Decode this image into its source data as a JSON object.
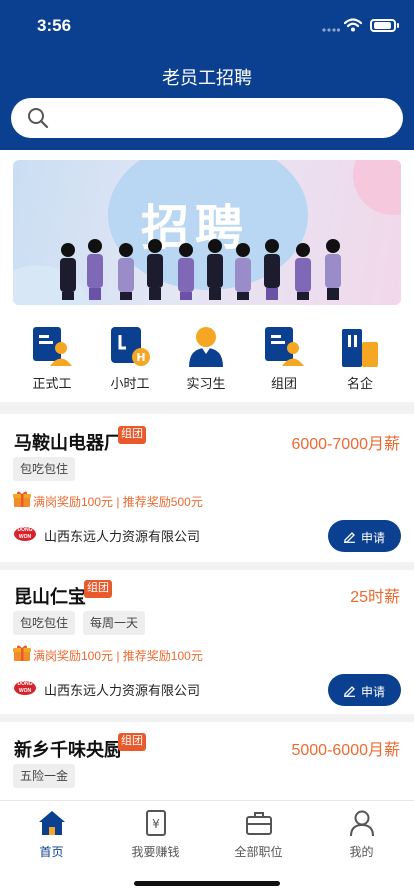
{
  "status_bar": {
    "time": "3:56"
  },
  "header": {
    "title": "老员工招聘",
    "search_placeholder": ""
  },
  "banner": {
    "text": "招聘"
  },
  "categories": [
    {
      "label": "正式工",
      "icon": "fulltime-icon"
    },
    {
      "label": "小时工",
      "icon": "hourly-icon"
    },
    {
      "label": "实习生",
      "icon": "intern-icon"
    },
    {
      "label": "组团",
      "icon": "group-icon"
    },
    {
      "label": "名企",
      "icon": "enterprise-icon"
    }
  ],
  "jobs": [
    {
      "name": "马鞍山电器厂",
      "badge": "组团",
      "salary": "6000-7000月薪",
      "tags": [
        "包吃包住"
      ],
      "reward": "满岗奖励100元 | 推荐奖励500元",
      "logo_text": "DONG WON",
      "company": "山西东远人力资源有限公司",
      "apply_label": "申请"
    },
    {
      "name": "昆山仁宝",
      "badge": "组团",
      "salary": "25时薪",
      "tags": [
        "包吃包住",
        "每周一天"
      ],
      "reward": "满岗奖励100元 | 推荐奖励100元",
      "logo_text": "DONG WON",
      "company": "山西东远人力资源有限公司",
      "apply_label": "申请"
    },
    {
      "name": "新乡千味央厨",
      "badge": "组团",
      "salary": "5000-6000月薪",
      "tags": [
        "五险一金"
      ]
    }
  ],
  "tabbar": [
    {
      "label": "首页",
      "icon": "home-icon",
      "active": true
    },
    {
      "label": "我要赚钱",
      "icon": "earn-icon",
      "active": false
    },
    {
      "label": "全部职位",
      "icon": "briefcase-icon",
      "active": false
    },
    {
      "label": "我的",
      "icon": "profile-icon",
      "active": false
    }
  ],
  "colors": {
    "primary": "#0b3f8f",
    "accent": "#ee6a32",
    "badge": "#e8592b",
    "icon_yellow": "#f5a623"
  }
}
